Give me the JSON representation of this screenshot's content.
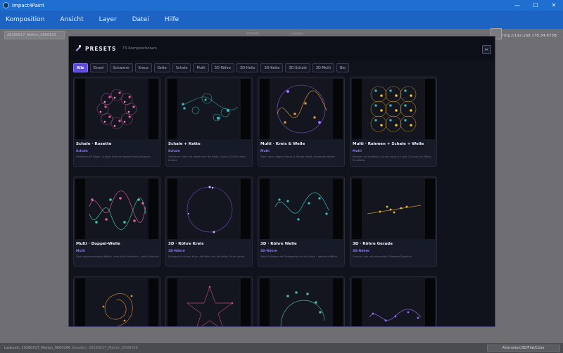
{
  "window": {
    "title": "Impact4Paint",
    "minimize": "—",
    "maximize": "☐",
    "close": "✕"
  },
  "menu": [
    "Komposition",
    "Ansicht",
    "Layer",
    "Datei",
    "Hilfe"
  ],
  "background": {
    "status_label": "20260517_Motion_0000155",
    "tab1": "Presets",
    "tab2": "Layers",
    "ip": "http://192.168.178.34:8758/",
    "bottom_left": "Ladezeit: 20260517_Motion_0000166",
    "bottom_mid": "Geladen: 20260517_Motion_0000166",
    "bottom_button": "Animation/3D/Flat/Color"
  },
  "presets": {
    "title": "PRESETS",
    "count": "73 Kompositionen",
    "close": "✂",
    "filters": [
      "Alle",
      "Einzel",
      "Schwarm",
      "Kreuz",
      "Kette",
      "Schale",
      "Multi",
      "3D-Röhre",
      "3D-Helix",
      "3D-Kette",
      "3D-Schale",
      "3D-Multi",
      "Bio"
    ],
    "active_filter": 0,
    "cards": [
      {
        "title": "Schale · Rosette",
        "category": "Schale",
        "desc": "Sechzehn elf Träger, in jeder Ecke ein kleiner Kreis-Schwarm",
        "accent": "#e05ea8"
      },
      {
        "title": "Schale + Kette",
        "category": "Schale",
        "desc": "Sieben im Kreis mit selbst eine Ton Kette, Layer & Drift in allen Kreisen",
        "accent": "#39c0c8"
      },
      {
        "title": "Multi · Kreis & Welle",
        "category": "Multi",
        "desc": "Zwei Layer, eigene Deltas & Tempo: Welle, kreisende Wellen",
        "accent": "#9a6cff"
      },
      {
        "title": "Multi · Rahmen + Schale + Welle",
        "category": "Multi",
        "desc": "Rahmen als Unterbau, Schale Layer & Layer C kreuzt hin: Welle, Rundkette",
        "accent": "#f2c128"
      },
      {
        "title": "Multi · Doppel-Welle",
        "category": "Multi",
        "desc": "Zwei phasenversetzte Wellen, eine läuft rückwärts – Helix-Eindruck",
        "accent": "#e25aa8"
      },
      {
        "title": "3D · Röhre Kreis",
        "category": "3D-Röhre",
        "desc": "Schwarm im einen Kreis, als Röhre um die tiefen Achse rotiert",
        "accent": "#7a5cf0"
      },
      {
        "title": "3D · Röhre Welle",
        "category": "3D-Röhre",
        "desc": "Welle Schwarm mit Drehwerte um die Achse – gedrehte Röhre",
        "accent": "#39c0c8"
      },
      {
        "title": "3D · Röhre Gerade",
        "category": "3D-Röhre",
        "desc": "Gerade Linie mit rotierender Schwarm-Drehsinn",
        "accent": "#f2c128"
      },
      {
        "title": "",
        "category": "",
        "desc": "",
        "accent": "#e0903a"
      },
      {
        "title": "",
        "category": "",
        "desc": "",
        "accent": "#d04a86"
      },
      {
        "title": "",
        "category": "",
        "desc": "",
        "accent": "#4fc8a8"
      },
      {
        "title": "",
        "category": "",
        "desc": "",
        "accent": "#9a6cff"
      }
    ]
  }
}
